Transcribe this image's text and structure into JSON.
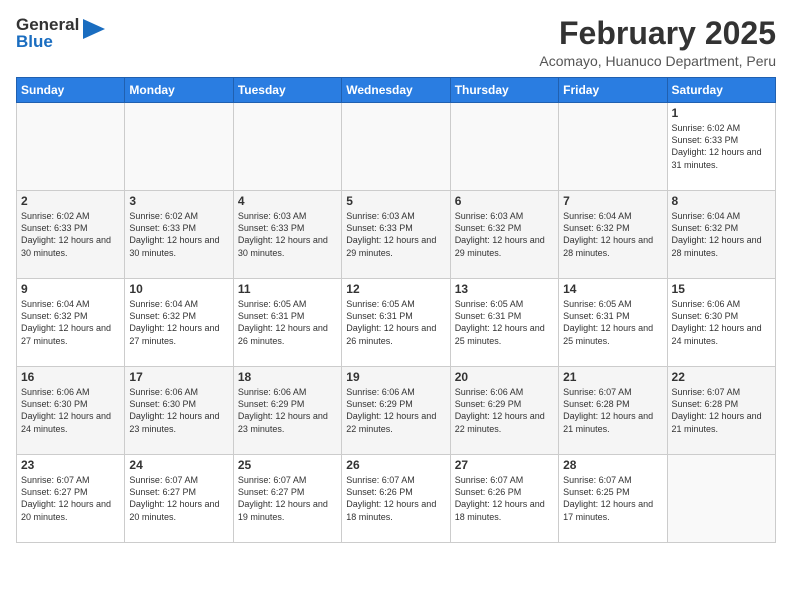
{
  "header": {
    "logo_general": "General",
    "logo_blue": "Blue",
    "month_title": "February 2025",
    "location": "Acomayo, Huanuco Department, Peru"
  },
  "days_of_week": [
    "Sunday",
    "Monday",
    "Tuesday",
    "Wednesday",
    "Thursday",
    "Friday",
    "Saturday"
  ],
  "weeks": [
    [
      {
        "day": "",
        "info": ""
      },
      {
        "day": "",
        "info": ""
      },
      {
        "day": "",
        "info": ""
      },
      {
        "day": "",
        "info": ""
      },
      {
        "day": "",
        "info": ""
      },
      {
        "day": "",
        "info": ""
      },
      {
        "day": "1",
        "info": "Sunrise: 6:02 AM\nSunset: 6:33 PM\nDaylight: 12 hours and 31 minutes."
      }
    ],
    [
      {
        "day": "2",
        "info": "Sunrise: 6:02 AM\nSunset: 6:33 PM\nDaylight: 12 hours and 30 minutes."
      },
      {
        "day": "3",
        "info": "Sunrise: 6:02 AM\nSunset: 6:33 PM\nDaylight: 12 hours and 30 minutes."
      },
      {
        "day": "4",
        "info": "Sunrise: 6:03 AM\nSunset: 6:33 PM\nDaylight: 12 hours and 30 minutes."
      },
      {
        "day": "5",
        "info": "Sunrise: 6:03 AM\nSunset: 6:33 PM\nDaylight: 12 hours and 29 minutes."
      },
      {
        "day": "6",
        "info": "Sunrise: 6:03 AM\nSunset: 6:32 PM\nDaylight: 12 hours and 29 minutes."
      },
      {
        "day": "7",
        "info": "Sunrise: 6:04 AM\nSunset: 6:32 PM\nDaylight: 12 hours and 28 minutes."
      },
      {
        "day": "8",
        "info": "Sunrise: 6:04 AM\nSunset: 6:32 PM\nDaylight: 12 hours and 28 minutes."
      }
    ],
    [
      {
        "day": "9",
        "info": "Sunrise: 6:04 AM\nSunset: 6:32 PM\nDaylight: 12 hours and 27 minutes."
      },
      {
        "day": "10",
        "info": "Sunrise: 6:04 AM\nSunset: 6:32 PM\nDaylight: 12 hours and 27 minutes."
      },
      {
        "day": "11",
        "info": "Sunrise: 6:05 AM\nSunset: 6:31 PM\nDaylight: 12 hours and 26 minutes."
      },
      {
        "day": "12",
        "info": "Sunrise: 6:05 AM\nSunset: 6:31 PM\nDaylight: 12 hours and 26 minutes."
      },
      {
        "day": "13",
        "info": "Sunrise: 6:05 AM\nSunset: 6:31 PM\nDaylight: 12 hours and 25 minutes."
      },
      {
        "day": "14",
        "info": "Sunrise: 6:05 AM\nSunset: 6:31 PM\nDaylight: 12 hours and 25 minutes."
      },
      {
        "day": "15",
        "info": "Sunrise: 6:06 AM\nSunset: 6:30 PM\nDaylight: 12 hours and 24 minutes."
      }
    ],
    [
      {
        "day": "16",
        "info": "Sunrise: 6:06 AM\nSunset: 6:30 PM\nDaylight: 12 hours and 24 minutes."
      },
      {
        "day": "17",
        "info": "Sunrise: 6:06 AM\nSunset: 6:30 PM\nDaylight: 12 hours and 23 minutes."
      },
      {
        "day": "18",
        "info": "Sunrise: 6:06 AM\nSunset: 6:29 PM\nDaylight: 12 hours and 23 minutes."
      },
      {
        "day": "19",
        "info": "Sunrise: 6:06 AM\nSunset: 6:29 PM\nDaylight: 12 hours and 22 minutes."
      },
      {
        "day": "20",
        "info": "Sunrise: 6:06 AM\nSunset: 6:29 PM\nDaylight: 12 hours and 22 minutes."
      },
      {
        "day": "21",
        "info": "Sunrise: 6:07 AM\nSunset: 6:28 PM\nDaylight: 12 hours and 21 minutes."
      },
      {
        "day": "22",
        "info": "Sunrise: 6:07 AM\nSunset: 6:28 PM\nDaylight: 12 hours and 21 minutes."
      }
    ],
    [
      {
        "day": "23",
        "info": "Sunrise: 6:07 AM\nSunset: 6:27 PM\nDaylight: 12 hours and 20 minutes."
      },
      {
        "day": "24",
        "info": "Sunrise: 6:07 AM\nSunset: 6:27 PM\nDaylight: 12 hours and 20 minutes."
      },
      {
        "day": "25",
        "info": "Sunrise: 6:07 AM\nSunset: 6:27 PM\nDaylight: 12 hours and 19 minutes."
      },
      {
        "day": "26",
        "info": "Sunrise: 6:07 AM\nSunset: 6:26 PM\nDaylight: 12 hours and 18 minutes."
      },
      {
        "day": "27",
        "info": "Sunrise: 6:07 AM\nSunset: 6:26 PM\nDaylight: 12 hours and 18 minutes."
      },
      {
        "day": "28",
        "info": "Sunrise: 6:07 AM\nSunset: 6:25 PM\nDaylight: 12 hours and 17 minutes."
      },
      {
        "day": "",
        "info": ""
      }
    ]
  ]
}
